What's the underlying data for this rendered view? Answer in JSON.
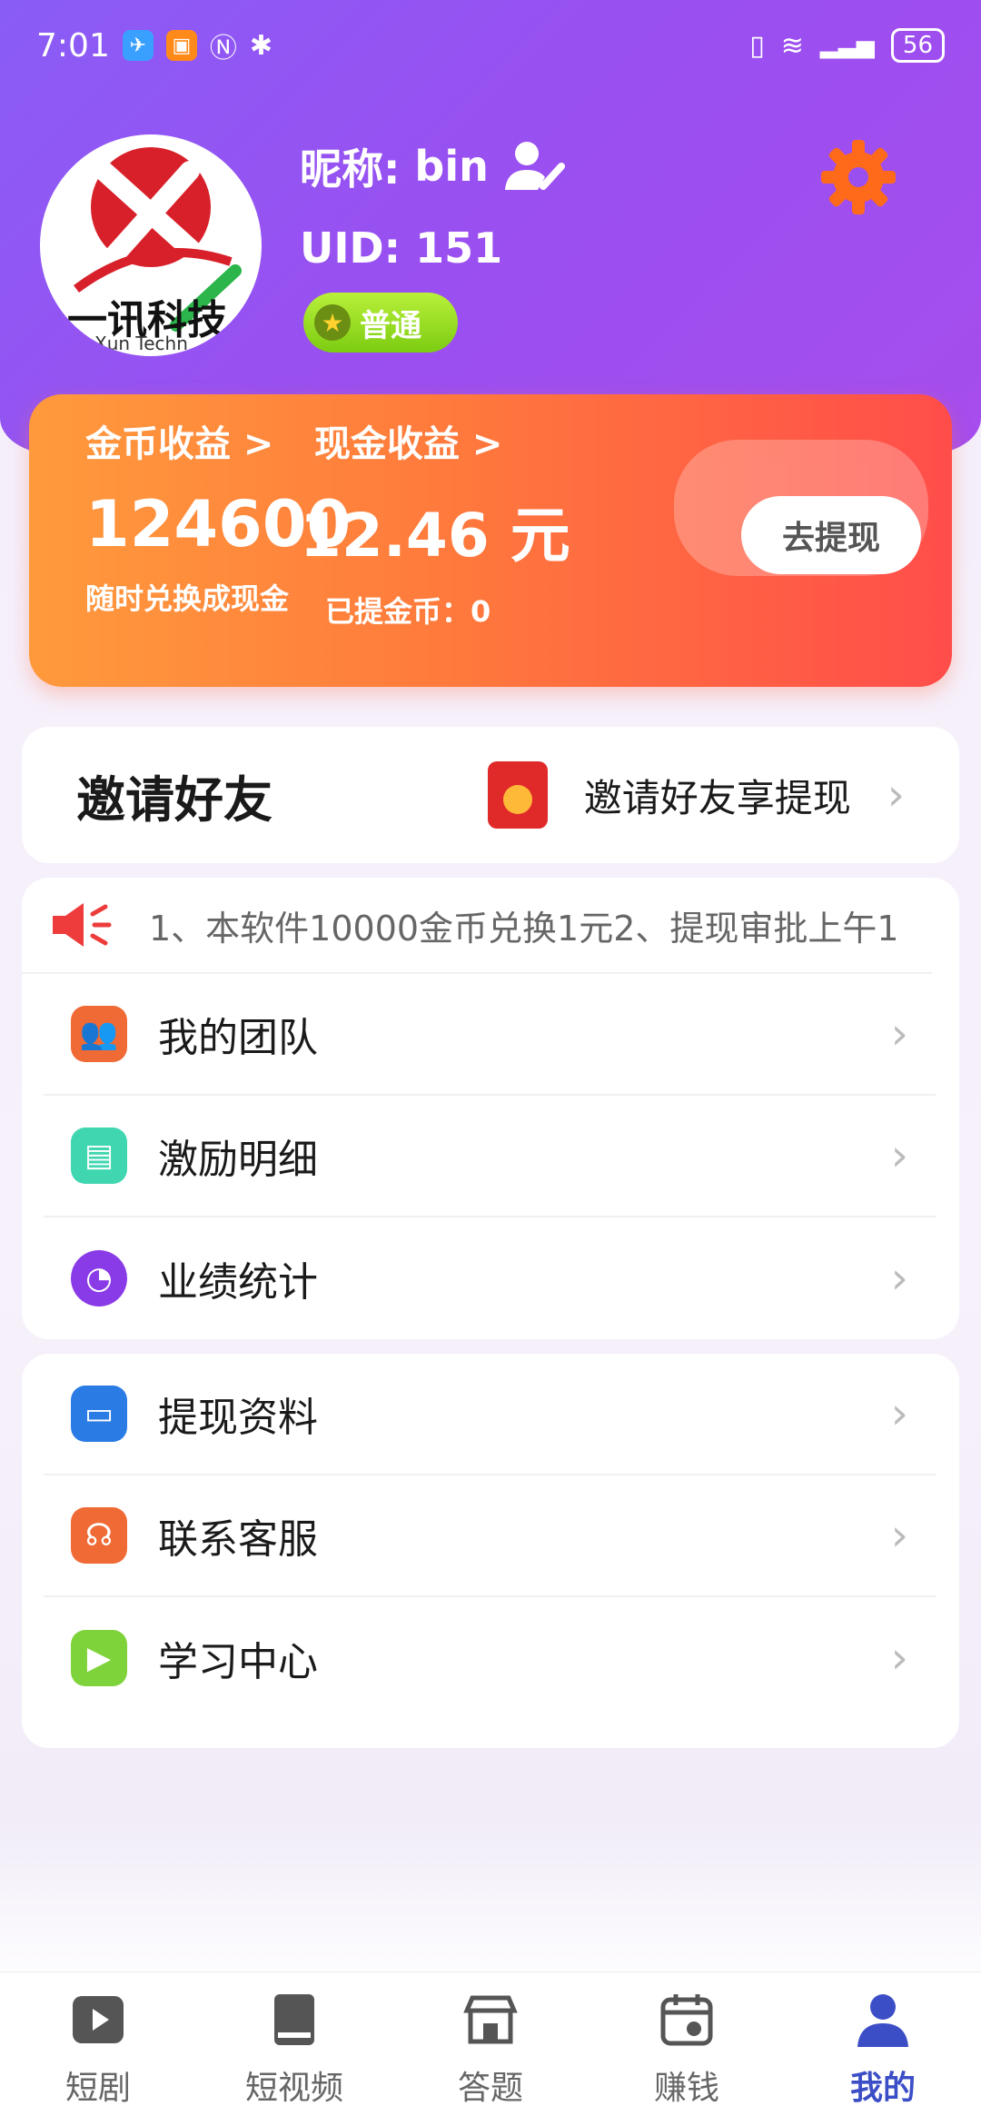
{
  "status_bar": {
    "time": "7:01",
    "battery": "56"
  },
  "profile": {
    "avatar_brand": "一讯科技",
    "avatar_sub": "Xun Techn",
    "nickname_label": "昵称:",
    "nickname": "bin",
    "uid_label": "UID:",
    "uid": "151",
    "level": "普通"
  },
  "earnings": {
    "coin_title": "金币收益 >",
    "coin_value": "124600",
    "coin_note": "随时兑换成现金",
    "cash_title": "现金收益 >",
    "cash_value": "12.46 元",
    "cash_note": "已提金币：0",
    "withdraw_label": "去提现"
  },
  "invite": {
    "title": "邀请好友",
    "action": "邀请好友享提现"
  },
  "notice": {
    "text": "1、本软件10000金币兑换1元2、提现审批上午1"
  },
  "menu_group1": [
    {
      "label": "我的团队",
      "icon": "team-icon",
      "color": "#f06a35"
    },
    {
      "label": "激励明细",
      "icon": "document-icon",
      "color": "#3fd6b0"
    },
    {
      "label": "业绩统计",
      "icon": "pie-chart-icon",
      "color": "#8a3be8"
    }
  ],
  "menu_group2": [
    {
      "label": "提现资料",
      "icon": "monitor-icon",
      "color": "#2a7be4"
    },
    {
      "label": "联系客服",
      "icon": "headset-icon",
      "color": "#f06a35"
    },
    {
      "label": "学习中心",
      "icon": "screen-play-icon",
      "color": "#7fd33a"
    }
  ],
  "bottom_nav": [
    {
      "label": "短剧",
      "icon": "play-icon",
      "active": false
    },
    {
      "label": "短视频",
      "icon": "book-icon",
      "active": false
    },
    {
      "label": "答题",
      "icon": "store-icon",
      "active": false
    },
    {
      "label": "赚钱",
      "icon": "calendar-icon",
      "active": false
    },
    {
      "label": "我的",
      "icon": "user-icon",
      "active": true
    }
  ],
  "colors": {
    "header_start": "#8a5cf6",
    "header_end": "#a64ded",
    "card_start": "#ff9a3c",
    "card_end": "#ff4d4a",
    "nav_active": "#3c4ec6",
    "settings_orange": "#ff6a1a"
  }
}
